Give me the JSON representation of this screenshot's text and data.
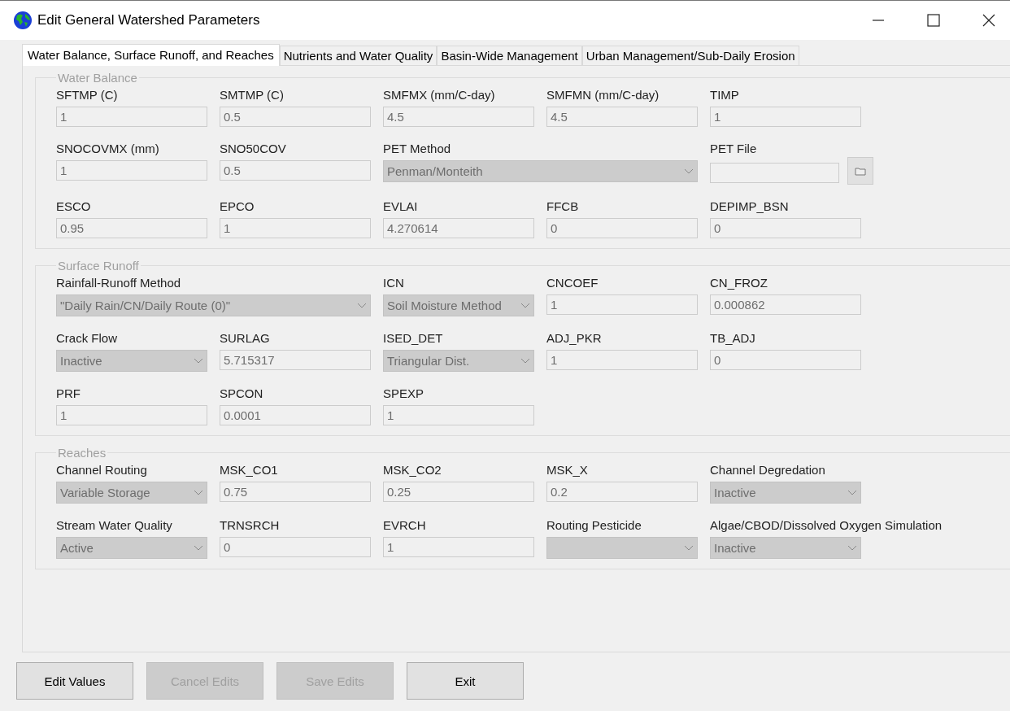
{
  "window": {
    "title": "Edit General Watershed Parameters"
  },
  "tabs": [
    {
      "label": "Water Balance, Surface Runoff, and Reaches",
      "selected": true
    },
    {
      "label": "Nutrients and Water Quality",
      "selected": false
    },
    {
      "label": "Basin-Wide Management",
      "selected": false
    },
    {
      "label": "Urban Management/Sub-Daily Erosion",
      "selected": false
    }
  ],
  "sections": [
    {
      "title": "Water Balance",
      "rows": [
        [
          {
            "kind": "text",
            "label": "SFTMP (C)",
            "value": "1"
          },
          {
            "kind": "text",
            "label": "SMTMP (C)",
            "value": "0.5"
          },
          {
            "kind": "text",
            "label": "SMFMX (mm/C-day)",
            "value": "4.5"
          },
          {
            "kind": "text",
            "label": "SMFMN (mm/C-day)",
            "value": "4.5"
          },
          {
            "kind": "text",
            "label": "TIMP",
            "value": "1"
          }
        ],
        [
          {
            "kind": "text",
            "label": "SNOCOVMX (mm)",
            "value": "1"
          },
          {
            "kind": "text",
            "label": "SNO50COV",
            "value": "0.5"
          },
          {
            "kind": "dropdown",
            "label": "PET Method",
            "value": "Penman/Monteith"
          },
          "",
          {
            "kind": "file",
            "label": "PET File"
          }
        ],
        [
          {
            "kind": "text",
            "label": "ESCO",
            "value": "0.95"
          },
          {
            "kind": "text",
            "label": "EPCO",
            "value": "1"
          },
          {
            "kind": "text",
            "label": "EVLAI",
            "value": "4.270614"
          },
          {
            "kind": "text",
            "label": "FFCB",
            "value": "0"
          },
          {
            "kind": "text",
            "label": "DEPIMP_BSN",
            "value": "0"
          }
        ]
      ]
    },
    {
      "title": "Surface Runoff",
      "rows": [
        [
          {
            "kind": "dropdown",
            "label": "Rainfall-Runoff Method",
            "value": "\"Daily Rain/CN/Daily Route (0)\""
          },
          "",
          {
            "kind": "dropdown",
            "label": "ICN",
            "value": "Soil Moisture Method"
          },
          {
            "kind": "text",
            "label": "CNCOEF",
            "value": "1"
          },
          {
            "kind": "text",
            "label": "CN_FROZ",
            "value": "0.000862"
          }
        ],
        [
          {
            "kind": "dropdown",
            "label": "Crack Flow",
            "value": "Inactive"
          },
          {
            "kind": "text",
            "label": "SURLAG",
            "value": "5.715317"
          },
          {
            "kind": "dropdown",
            "label": "ISED_DET",
            "value": "Triangular Dist."
          },
          {
            "kind": "text",
            "label": "ADJ_PKR",
            "value": "1"
          },
          {
            "kind": "text",
            "label": "TB_ADJ",
            "value": "0"
          }
        ],
        [
          {
            "kind": "text",
            "label": "PRF",
            "value": "1"
          },
          {
            "kind": "text",
            "label": "SPCON",
            "value": "0.0001"
          },
          {
            "kind": "text",
            "label": "SPEXP",
            "value": "1"
          }
        ]
      ]
    },
    {
      "title": "Reaches",
      "rows": [
        [
          {
            "kind": "dropdown",
            "label": "Channel Routing",
            "value": "Variable Storage"
          },
          {
            "kind": "text",
            "label": "MSK_CO1",
            "value": "0.75"
          },
          {
            "kind": "text",
            "label": "MSK_CO2",
            "value": "0.25"
          },
          {
            "kind": "text",
            "label": "MSK_X",
            "value": "0.2"
          },
          {
            "kind": "dropdown",
            "label": "Channel Degredation",
            "value": "Inactive"
          }
        ],
        [
          {
            "kind": "dropdown",
            "label": "Stream Water Quality",
            "value": "Active"
          },
          {
            "kind": "text",
            "label": "TRNSRCH",
            "value": "0"
          },
          {
            "kind": "text",
            "label": "EVRCH",
            "value": "1"
          },
          {
            "kind": "dropdown",
            "label": "Routing Pesticide"
          },
          {
            "kind": "dropdown",
            "label": "Algae/CBOD/Dissolved Oxygen Simulation",
            "value": "Inactive"
          }
        ]
      ]
    }
  ],
  "buttons": [
    {
      "label": "Edit Values",
      "disabled": false
    },
    {
      "label": "Cancel Edits",
      "disabled": true
    },
    {
      "label": "Save Edits",
      "disabled": true
    },
    {
      "label": "Exit",
      "disabled": false
    }
  ]
}
